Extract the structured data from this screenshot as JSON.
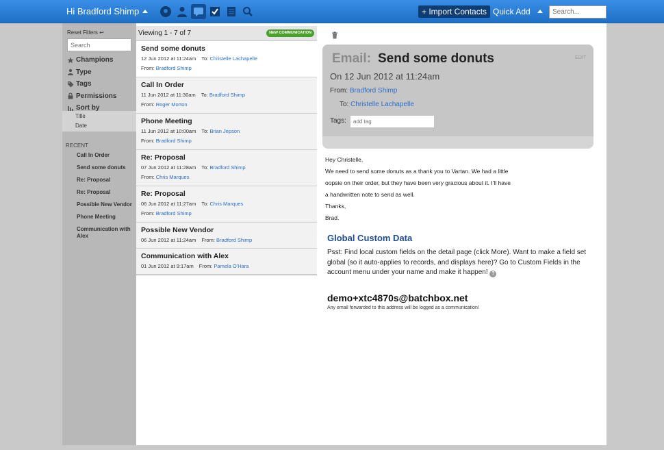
{
  "topbar": {
    "greeting": "Hi Bradford Shimp",
    "import_label": "+ Import Contacts",
    "quickadd_label": "Quick Add",
    "search_placeholder": "Search..."
  },
  "sidebar": {
    "reset_label": "Reset Filters ↩",
    "search_placeholder": "Search",
    "filters": [
      {
        "label": "Champions",
        "icon": "star-icon"
      },
      {
        "label": "Type",
        "icon": "person-icon"
      },
      {
        "label": "Tags",
        "icon": "tag-icon"
      },
      {
        "label": "Permissions",
        "icon": "lock-icon"
      },
      {
        "label": "Sort by",
        "icon": "bars-icon"
      }
    ],
    "sort_options": [
      "Title",
      "Date"
    ],
    "recent_label": "RECENT",
    "recent": [
      "Call In Order",
      "Send some donuts",
      "Re: Proposal",
      "Re: Proposal",
      "Possible New Vendor",
      "Phone Meeting",
      "Communication with Alex"
    ]
  },
  "list": {
    "viewing": "Viewing 1 - 7 of 7",
    "new_label": "NEW COMMUNICATION",
    "items": [
      {
        "title": "Send some donuts",
        "date": "12 Jun 2012 at 11:24am",
        "to": "Christelle Lachapelle",
        "from": "Bradford Shimp"
      },
      {
        "title": "Call In Order",
        "date": "11 Jun 2012 at 11:30am",
        "to": "Bradford Shimp",
        "from": "Roger Morton"
      },
      {
        "title": "Phone Meeting",
        "date": "11 Jun 2012 at 10:00am",
        "to": "Brian Jepson",
        "from": "Bradford Shimp"
      },
      {
        "title": "Re: Proposal",
        "date": "07 Jun 2012 at 11:28am",
        "to": "Bradford Shimp",
        "from": "Chris Marques"
      },
      {
        "title": "Re: Proposal",
        "date": "06 Jun 2012 at 11:27am",
        "to": "Chris Marques",
        "from": "Bradford Shimp"
      },
      {
        "title": "Possible New Vendor",
        "date": "06 Jun 2012 at 11:24am",
        "from": "Bradford Shimp"
      },
      {
        "title": "Communication with Alex",
        "date": "01 Jun 2012 at 9:17am",
        "from": "Pamela O'Hara"
      }
    ],
    "to_prefix": "To:",
    "from_prefix": "From:"
  },
  "detail": {
    "kind": "Email:",
    "subject": "Send some donuts",
    "edit_label": "EDIT",
    "date": "On 12 Jun 2012 at 11:24am",
    "from_label": "From:",
    "from": "Bradford Shimp",
    "to_label": "To:",
    "to": "Christelle Lachapelle",
    "tags_label": "Tags:",
    "tag_placeholder": "add tag",
    "body": [
      "Hey Christelle,",
      "We need to send some donuts as a thank you to Vartan. We had a little",
      "oopsie on their order, but they have been very gracious about it. I'll have",
      "a handwritten note to send as well.",
      "Thanks,",
      "Brad."
    ],
    "gcd_title": "Global Custom Data",
    "gcd_text": "Psst: Find local custom fields on the detail page (click More). Want to make a field set global (so it auto-applies to records, and displays here)? Go to Custom Fields in the account menu under your name and make it happen!",
    "email_address": "demo+xtc4870s@batchbox.net",
    "email_note": "Any email forwarded to this address will be logged as a communication!"
  }
}
